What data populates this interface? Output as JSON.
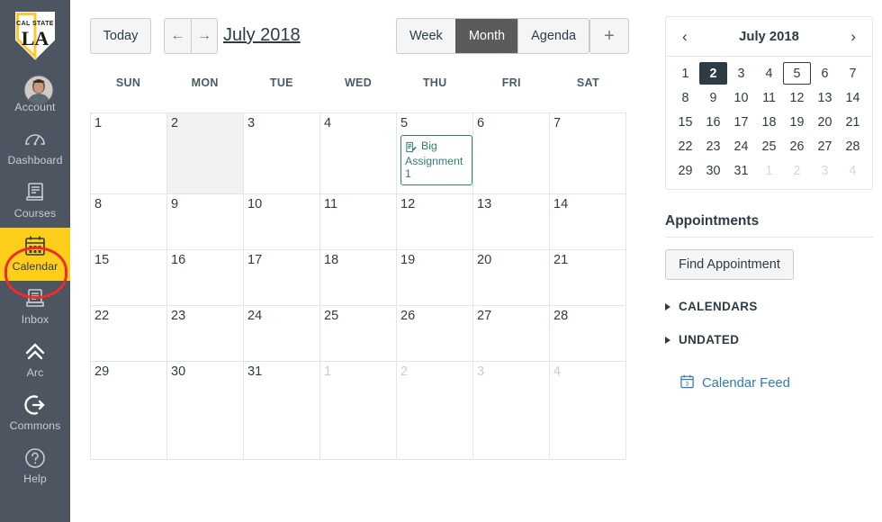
{
  "globalnav": {
    "logo": {
      "name": "cal-state-la-logo",
      "line1": "CAL STATE",
      "line2": "LA",
      "shield_color": "#ffffff",
      "accent_color": "#FFC72C"
    },
    "background": "#4c5560",
    "active_color": "#FFCE1B",
    "items": [
      {
        "label": "Account",
        "icon": "avatar-icon",
        "active": false
      },
      {
        "label": "Dashboard",
        "icon": "dashboard-icon",
        "active": false
      },
      {
        "label": "Courses",
        "icon": "courses-icon",
        "active": false
      },
      {
        "label": "Calendar",
        "icon": "calendar-icon",
        "active": true
      },
      {
        "label": "Inbox",
        "icon": "inbox-icon",
        "active": false
      },
      {
        "label": "Arc",
        "icon": "arc-icon",
        "active": false
      },
      {
        "label": "Commons",
        "icon": "commons-icon",
        "active": false
      },
      {
        "label": "Help",
        "icon": "help-icon",
        "active": false
      }
    ],
    "annotation": {
      "shape": "ellipse",
      "color": "#ee2c2c",
      "target": "Calendar"
    }
  },
  "toolbar": {
    "today_label": "Today",
    "prev_label": "←",
    "next_label": "→",
    "period_title": "July 2018",
    "views": [
      {
        "label": "Week",
        "selected": false
      },
      {
        "label": "Month",
        "selected": true
      },
      {
        "label": "Agenda",
        "selected": false
      }
    ],
    "add_label": "+",
    "selected_view_bg": "#5b5b5b"
  },
  "calendar": {
    "weekdays": [
      "SUN",
      "MON",
      "TUE",
      "WED",
      "THU",
      "FRI",
      "SAT"
    ],
    "today_bg": "#f2f2f2",
    "weeks": [
      [
        {
          "day": "1",
          "other": false,
          "today": false,
          "events": []
        },
        {
          "day": "2",
          "other": false,
          "today": true,
          "events": []
        },
        {
          "day": "3",
          "other": false,
          "today": false,
          "events": []
        },
        {
          "day": "4",
          "other": false,
          "today": false,
          "events": []
        },
        {
          "day": "5",
          "other": false,
          "today": false,
          "events": [
            {
              "title": "Big Assignment 1",
              "icon": "assignment-icon",
              "color": "#2f7e6e"
            }
          ]
        },
        {
          "day": "6",
          "other": false,
          "today": false,
          "events": []
        },
        {
          "day": "7",
          "other": false,
          "today": false,
          "events": []
        }
      ],
      [
        {
          "day": "8",
          "other": false,
          "today": false,
          "events": []
        },
        {
          "day": "9",
          "other": false,
          "today": false,
          "events": []
        },
        {
          "day": "10",
          "other": false,
          "today": false,
          "events": []
        },
        {
          "day": "11",
          "other": false,
          "today": false,
          "events": []
        },
        {
          "day": "12",
          "other": false,
          "today": false,
          "events": []
        },
        {
          "day": "13",
          "other": false,
          "today": false,
          "events": []
        },
        {
          "day": "14",
          "other": false,
          "today": false,
          "events": []
        }
      ],
      [
        {
          "day": "15",
          "other": false,
          "today": false,
          "events": []
        },
        {
          "day": "16",
          "other": false,
          "today": false,
          "events": []
        },
        {
          "day": "17",
          "other": false,
          "today": false,
          "events": []
        },
        {
          "day": "18",
          "other": false,
          "today": false,
          "events": []
        },
        {
          "day": "19",
          "other": false,
          "today": false,
          "events": []
        },
        {
          "day": "20",
          "other": false,
          "today": false,
          "events": []
        },
        {
          "day": "21",
          "other": false,
          "today": false,
          "events": []
        }
      ],
      [
        {
          "day": "22",
          "other": false,
          "today": false,
          "events": []
        },
        {
          "day": "23",
          "other": false,
          "today": false,
          "events": []
        },
        {
          "day": "24",
          "other": false,
          "today": false,
          "events": []
        },
        {
          "day": "25",
          "other": false,
          "today": false,
          "events": []
        },
        {
          "day": "26",
          "other": false,
          "today": false,
          "events": []
        },
        {
          "day": "27",
          "other": false,
          "today": false,
          "events": []
        },
        {
          "day": "28",
          "other": false,
          "today": false,
          "events": []
        }
      ],
      [
        {
          "day": "29",
          "other": false,
          "today": false,
          "events": []
        },
        {
          "day": "30",
          "other": false,
          "today": false,
          "events": []
        },
        {
          "day": "31",
          "other": false,
          "today": false,
          "events": []
        },
        {
          "day": "1",
          "other": true,
          "today": false,
          "events": []
        },
        {
          "day": "2",
          "other": true,
          "today": false,
          "events": []
        },
        {
          "day": "3",
          "other": true,
          "today": false,
          "events": []
        },
        {
          "day": "4",
          "other": true,
          "today": false,
          "events": []
        }
      ]
    ]
  },
  "minicalendar": {
    "prev_label": "‹",
    "next_label": "›",
    "title": "July 2018",
    "selected_bg": "#2d3b45",
    "days": [
      {
        "d": "1",
        "other": false,
        "selected": false,
        "event": false
      },
      {
        "d": "2",
        "other": false,
        "selected": true,
        "event": false
      },
      {
        "d": "3",
        "other": false,
        "selected": false,
        "event": false
      },
      {
        "d": "4",
        "other": false,
        "selected": false,
        "event": false
      },
      {
        "d": "5",
        "other": false,
        "selected": false,
        "event": true
      },
      {
        "d": "6",
        "other": false,
        "selected": false,
        "event": false
      },
      {
        "d": "7",
        "other": false,
        "selected": false,
        "event": false
      },
      {
        "d": "8",
        "other": false,
        "selected": false,
        "event": false
      },
      {
        "d": "9",
        "other": false,
        "selected": false,
        "event": false
      },
      {
        "d": "10",
        "other": false,
        "selected": false,
        "event": false
      },
      {
        "d": "11",
        "other": false,
        "selected": false,
        "event": false
      },
      {
        "d": "12",
        "other": false,
        "selected": false,
        "event": false
      },
      {
        "d": "13",
        "other": false,
        "selected": false,
        "event": false
      },
      {
        "d": "14",
        "other": false,
        "selected": false,
        "event": false
      },
      {
        "d": "15",
        "other": false,
        "selected": false,
        "event": false
      },
      {
        "d": "16",
        "other": false,
        "selected": false,
        "event": false
      },
      {
        "d": "17",
        "other": false,
        "selected": false,
        "event": false
      },
      {
        "d": "18",
        "other": false,
        "selected": false,
        "event": false
      },
      {
        "d": "19",
        "other": false,
        "selected": false,
        "event": false
      },
      {
        "d": "20",
        "other": false,
        "selected": false,
        "event": false
      },
      {
        "d": "21",
        "other": false,
        "selected": false,
        "event": false
      },
      {
        "d": "22",
        "other": false,
        "selected": false,
        "event": false
      },
      {
        "d": "23",
        "other": false,
        "selected": false,
        "event": false
      },
      {
        "d": "24",
        "other": false,
        "selected": false,
        "event": false
      },
      {
        "d": "25",
        "other": false,
        "selected": false,
        "event": false
      },
      {
        "d": "26",
        "other": false,
        "selected": false,
        "event": false
      },
      {
        "d": "27",
        "other": false,
        "selected": false,
        "event": false
      },
      {
        "d": "28",
        "other": false,
        "selected": false,
        "event": false
      },
      {
        "d": "29",
        "other": false,
        "selected": false,
        "event": false
      },
      {
        "d": "30",
        "other": false,
        "selected": false,
        "event": false
      },
      {
        "d": "31",
        "other": false,
        "selected": false,
        "event": false
      },
      {
        "d": "1",
        "other": true,
        "selected": false,
        "event": false
      },
      {
        "d": "2",
        "other": true,
        "selected": false,
        "event": false
      },
      {
        "d": "3",
        "other": true,
        "selected": false,
        "event": false
      },
      {
        "d": "4",
        "other": true,
        "selected": false,
        "event": false
      }
    ]
  },
  "sidebar": {
    "appointments_title": "Appointments",
    "find_appointment_label": "Find Appointment",
    "sections": [
      {
        "label": "CALENDARS",
        "expanded": false
      },
      {
        "label": "UNDATED",
        "expanded": false
      }
    ],
    "feed_label": "Calendar Feed",
    "feed_icon": "calendar-feed-icon",
    "link_color": "#2B7ABC"
  }
}
